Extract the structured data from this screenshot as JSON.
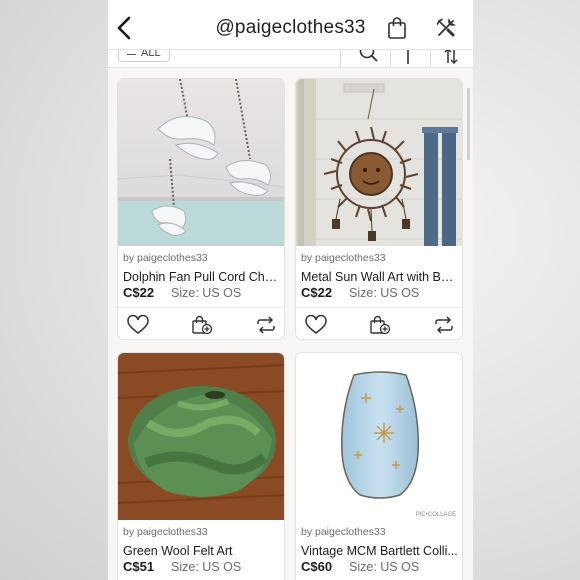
{
  "header": {
    "back_icon": "chevron-left-icon",
    "title": "@paigeclothes33",
    "bag_icon": "shopping-bag-icon",
    "tools_icon": "tools-icon"
  },
  "filter_bar": {
    "filter_label": "ALL",
    "search_icon": "search-icon",
    "sort_icon": "sort-icon"
  },
  "listings": [
    {
      "byline": "by paigeclothes33",
      "title": "Dolphin Fan Pull Cord Cha...",
      "price": "C$22",
      "size": "Size: US OS",
      "photo": "glass dolphin fan pulls"
    },
    {
      "byline": "by paigeclothes33",
      "title": "Metal Sun Wall Art with Bells",
      "price": "C$22",
      "size": "Size: US OS",
      "photo": "metal sun wall art"
    },
    {
      "byline": "by paigeclothes33",
      "title": "Green Wool Felt Art",
      "price": "C$51",
      "size": "Size: US OS",
      "photo": "green felt vessel"
    },
    {
      "byline": "by paigeclothes33",
      "title": "Vintage MCM Bartlett Colli...",
      "price": "C$60",
      "size": "Size: US OS",
      "photo": "blue starburst vase",
      "watermark": "PIC•COLLAGE"
    }
  ],
  "card_actions": [
    "heart-icon",
    "add-to-bag-icon",
    "share-icon"
  ],
  "colors": {
    "background": "#f7f6f4",
    "text": "#1c1c1c",
    "muted": "#6d6d6d"
  }
}
